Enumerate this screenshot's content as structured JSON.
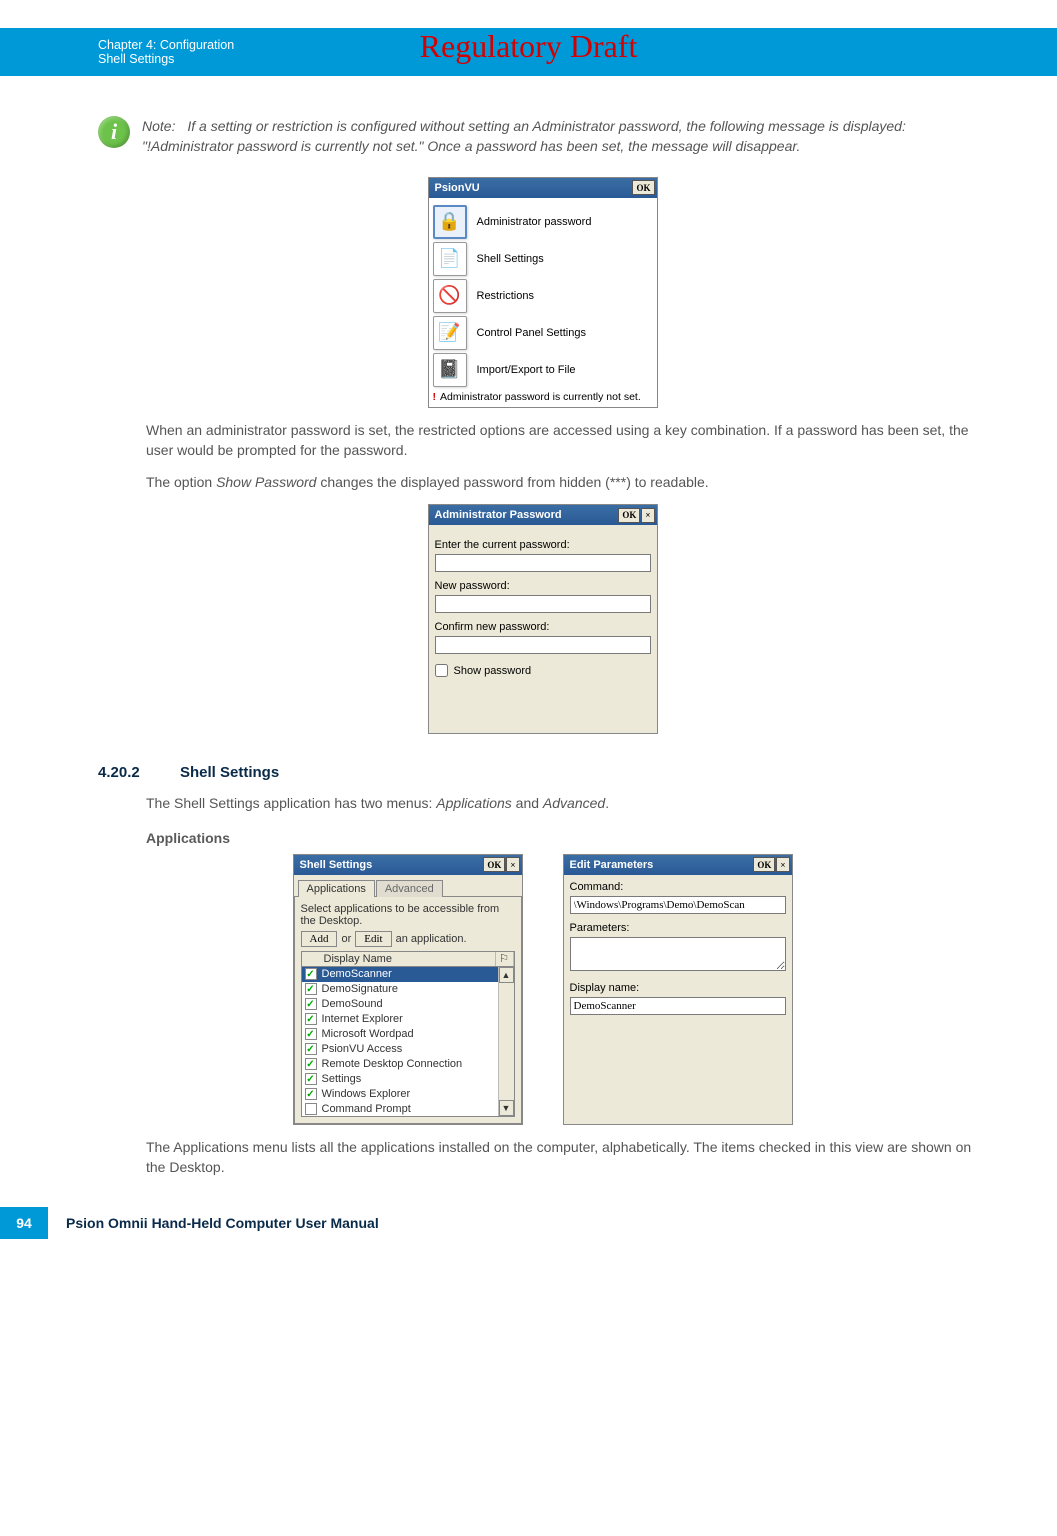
{
  "watermark": "Regulatory Draft",
  "header": {
    "line1": "Chapter 4:  Configuration",
    "line2": "Shell Settings"
  },
  "note": {
    "label": "Note:",
    "text": "If a setting or restriction is configured without setting an Administrator password, the following message is displayed: \"!Administrator password is currently not set.\" Once a password has been set, the message will disappear."
  },
  "psionvu": {
    "title": "PsionVU",
    "ok": "OK",
    "items": [
      "Administrator password",
      "Shell Settings",
      "Restrictions",
      "Control Panel Settings",
      "Import/Export to File"
    ],
    "warn_bang": "!",
    "warn": "Administrator password is currently not set."
  },
  "para1": "When an administrator password is set, the restricted options are accessed using a key combination. If a password has been set, the user would be prompted for the password.",
  "para2a": "The option ",
  "para2b": "Show Password",
  "para2c": " changes the displayed password from hidden (***) to readable.",
  "adminpw": {
    "title": "Administrator Password",
    "ok": "OK",
    "close": "×",
    "l1": "Enter the current password:",
    "l2": "New password:",
    "l3": "Confirm new password:",
    "show": "Show password"
  },
  "section": {
    "num": "4.20.2",
    "title": "Shell Settings"
  },
  "para3a": "The Shell Settings application has two menus: ",
  "para3b": "Applications",
  "para3c": " and ",
  "para3d": "Advanced",
  "para3e": ".",
  "subhead": "Applications",
  "shell": {
    "title": "Shell Settings",
    "ok": "OK",
    "close": "×",
    "tab_apps": "Applications",
    "tab_adv": "Advanced",
    "instr": "Select applications to be accessible from the Desktop.",
    "add": "Add",
    "or": "or",
    "edit": "Edit",
    "tail": "an application.",
    "col": "Display Name",
    "items": [
      {
        "name": "DemoScanner",
        "checked": true,
        "sel": true
      },
      {
        "name": "DemoSignature",
        "checked": true
      },
      {
        "name": "DemoSound",
        "checked": true
      },
      {
        "name": "Internet Explorer",
        "checked": true
      },
      {
        "name": "Microsoft Wordpad",
        "checked": true
      },
      {
        "name": "PsionVU Access",
        "checked": true
      },
      {
        "name": "Remote Desktop Connection",
        "checked": true
      },
      {
        "name": "Settings",
        "checked": true
      },
      {
        "name": "Windows Explorer",
        "checked": true
      },
      {
        "name": "Command Prompt",
        "checked": false
      }
    ]
  },
  "editparams": {
    "title": "Edit Parameters",
    "ok": "OK",
    "close": "×",
    "l_cmd": "Command:",
    "v_cmd": "\\Windows\\Programs\\Demo\\DemoScan",
    "l_params": "Parameters:",
    "v_params": "",
    "l_disp": "Display name:",
    "v_disp": "DemoScanner"
  },
  "para4": "The Applications menu lists all the applications installed on the computer, alphabetically. The items checked in this view are shown on the Desktop.",
  "footer": {
    "page": "94",
    "title": "Psion Omnii Hand-Held Computer User Manual"
  },
  "icons": {
    "lock": "🔒",
    "shell": "📄",
    "restrict": "🚫",
    "cpanel": "📝",
    "import": "📓"
  }
}
